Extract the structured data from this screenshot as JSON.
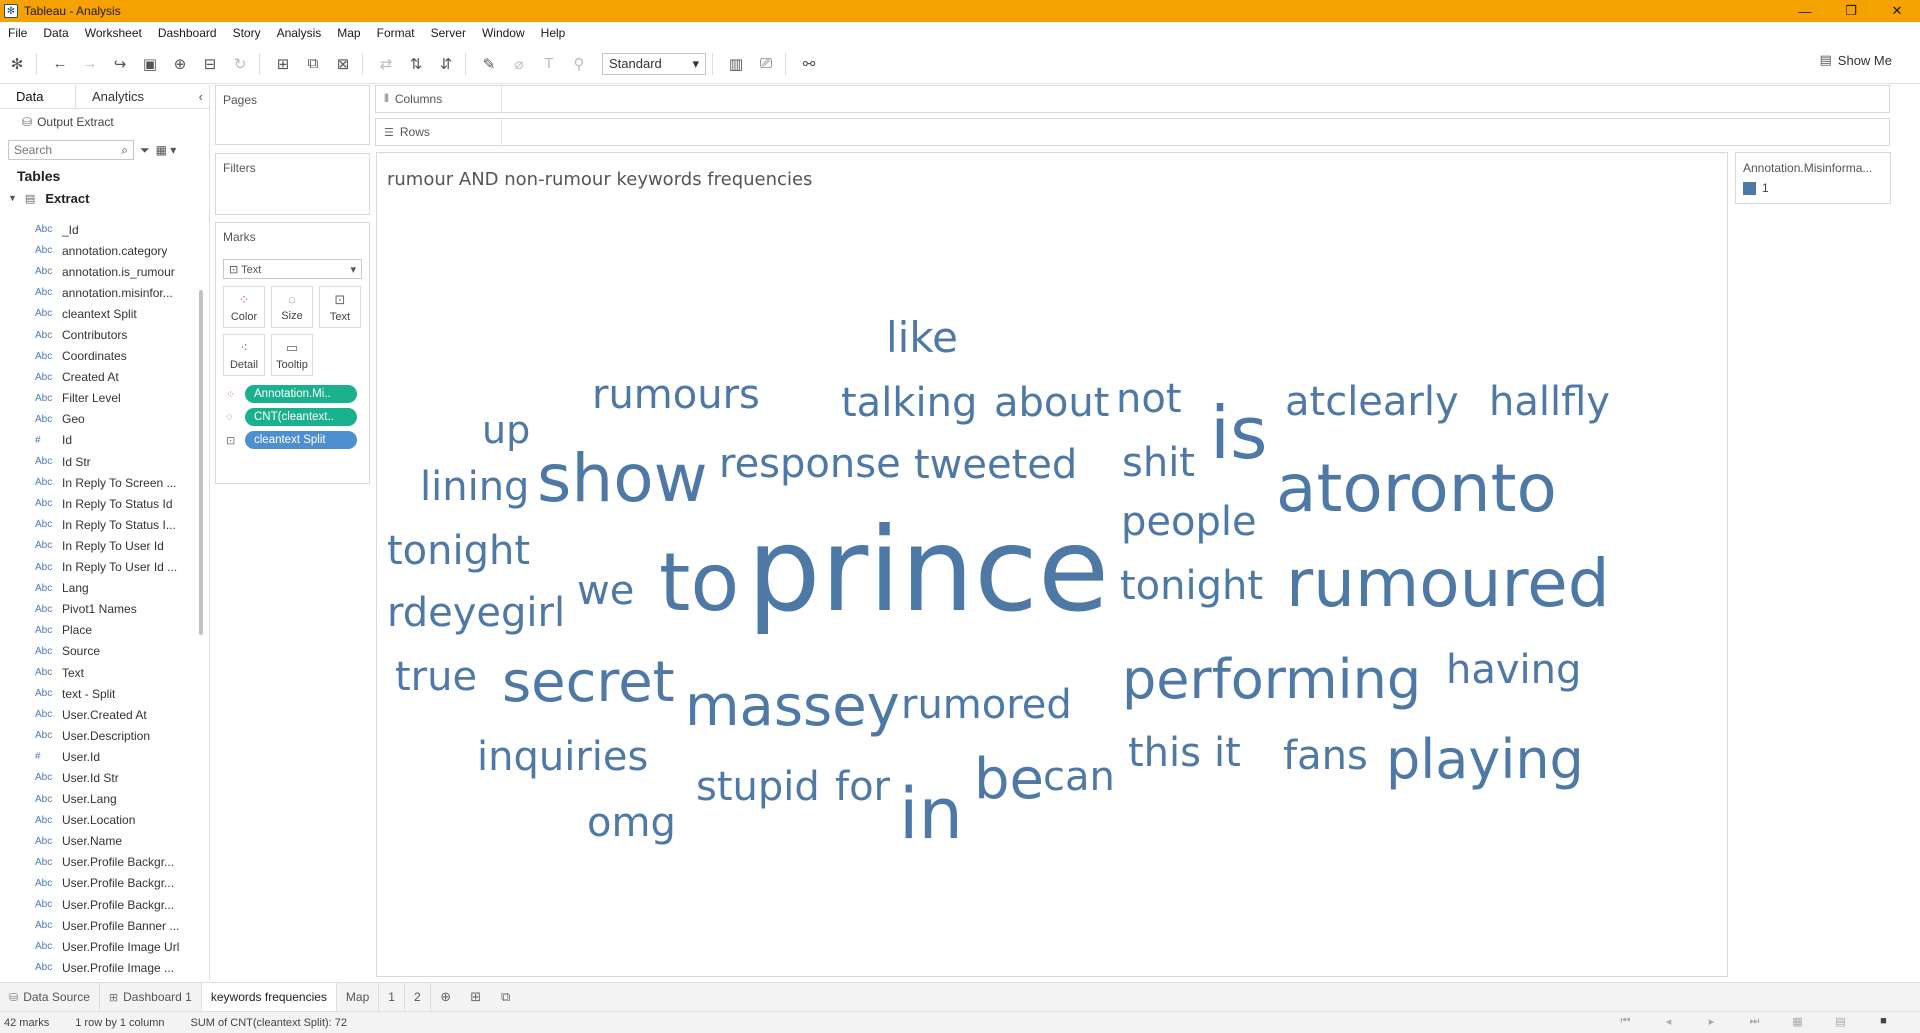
{
  "window": {
    "title": "Tableau - Analysis"
  },
  "menu": [
    "File",
    "Data",
    "Worksheet",
    "Dashboard",
    "Story",
    "Analysis",
    "Map",
    "Format",
    "Server",
    "Window",
    "Help"
  ],
  "toolbar": {
    "fit_select": "Standard",
    "show_me": "Show Me"
  },
  "data_pane": {
    "tab_data": "Data",
    "tab_analytics": "Analytics",
    "data_source": "Output Extract",
    "search_placeholder": "Search",
    "tables_header": "Tables",
    "table_name": "Extract",
    "fields": [
      {
        "type": "Abc",
        "name": "_Id"
      },
      {
        "type": "Abc",
        "name": "annotation.category"
      },
      {
        "type": "Abc",
        "name": "annotation.is_rumour"
      },
      {
        "type": "Abc",
        "name": "annotation.misinfor..."
      },
      {
        "type": "Abc",
        "name": "cleantext Split"
      },
      {
        "type": "Abc",
        "name": "Contributors"
      },
      {
        "type": "Abc",
        "name": "Coordinates"
      },
      {
        "type": "Abc",
        "name": "Created At"
      },
      {
        "type": "Abc",
        "name": "Filter Level"
      },
      {
        "type": "Abc",
        "name": "Geo"
      },
      {
        "type": "#",
        "name": "Id"
      },
      {
        "type": "Abc",
        "name": "Id Str"
      },
      {
        "type": "Abc",
        "name": "In Reply To Screen ..."
      },
      {
        "type": "Abc",
        "name": "In Reply To Status Id"
      },
      {
        "type": "Abc",
        "name": "In Reply To Status I..."
      },
      {
        "type": "Abc",
        "name": "In Reply To User Id"
      },
      {
        "type": "Abc",
        "name": "In Reply To User Id ..."
      },
      {
        "type": "Abc",
        "name": "Lang"
      },
      {
        "type": "Abc",
        "name": "Pivot1 Names"
      },
      {
        "type": "Abc",
        "name": "Place"
      },
      {
        "type": "Abc",
        "name": "Source"
      },
      {
        "type": "Abc",
        "name": "Text"
      },
      {
        "type": "Abc",
        "name": "text - Split"
      },
      {
        "type": "Abc",
        "name": "User.Created At"
      },
      {
        "type": "Abc",
        "name": "User.Description"
      },
      {
        "type": "#",
        "name": "User.Id"
      },
      {
        "type": "Abc",
        "name": "User.Id Str"
      },
      {
        "type": "Abc",
        "name": "User.Lang"
      },
      {
        "type": "Abc",
        "name": "User.Location"
      },
      {
        "type": "Abc",
        "name": "User.Name"
      },
      {
        "type": "Abc",
        "name": "User.Profile Backgr..."
      },
      {
        "type": "Abc",
        "name": "User.Profile Backgr..."
      },
      {
        "type": "Abc",
        "name": "User.Profile Backgr..."
      },
      {
        "type": "Abc",
        "name": "User.Profile Banner ..."
      },
      {
        "type": "Abc",
        "name": "User.Profile Image Url"
      },
      {
        "type": "Abc",
        "name": "User.Profile Image ..."
      }
    ]
  },
  "shelves": {
    "pages": "Pages",
    "filters": "Filters",
    "marks": "Marks",
    "marks_type": "Text",
    "columns": "Columns",
    "rows": "Rows",
    "mark_buttons": {
      "color": "Color",
      "size": "Size",
      "text": "Text",
      "detail": "Detail",
      "tooltip": "Tooltip"
    },
    "pills": [
      "Annotation.Mi..",
      "CNT(cleantext..",
      "cleantext Split"
    ]
  },
  "view": {
    "title": "rumour AND non-rumour keywords frequencies",
    "words": [
      {
        "text": "like",
        "size": 42
      },
      {
        "text": "rumours",
        "size": 40
      },
      {
        "text": "talking",
        "size": 40
      },
      {
        "text": "about",
        "size": 40
      },
      {
        "text": "not",
        "size": 40
      },
      {
        "text": "is",
        "size": 72
      },
      {
        "text": "atclearly",
        "size": 40
      },
      {
        "text": "hallfly",
        "size": 40
      },
      {
        "text": "up",
        "size": 38
      },
      {
        "text": "show",
        "size": 66
      },
      {
        "text": "response",
        "size": 40
      },
      {
        "text": "tweeted",
        "size": 40
      },
      {
        "text": "shit",
        "size": 40
      },
      {
        "text": "atoronto",
        "size": 66
      },
      {
        "text": "lining",
        "size": 40
      },
      {
        "text": "people",
        "size": 40
      },
      {
        "text": "tonight",
        "size": 40
      },
      {
        "text": "we",
        "size": 40
      },
      {
        "text": "to",
        "size": 80
      },
      {
        "text": "prince",
        "size": 116
      },
      {
        "text": "tonight",
        "size": 40
      },
      {
        "text": "rumoured",
        "size": 66
      },
      {
        "text": "rdeyegirl",
        "size": 40
      },
      {
        "text": "true",
        "size": 40
      },
      {
        "text": "secret",
        "size": 56
      },
      {
        "text": "massey",
        "size": 56
      },
      {
        "text": "rumored",
        "size": 40
      },
      {
        "text": "performing",
        "size": 54
      },
      {
        "text": "having",
        "size": 40
      },
      {
        "text": "inquiries",
        "size": 40
      },
      {
        "text": "stupid",
        "size": 40
      },
      {
        "text": "for",
        "size": 40
      },
      {
        "text": "in",
        "size": 70
      },
      {
        "text": "be",
        "size": 56
      },
      {
        "text": "can",
        "size": 40
      },
      {
        "text": "this",
        "size": 40
      },
      {
        "text": "it",
        "size": 40
      },
      {
        "text": "fans",
        "size": 40
      },
      {
        "text": "playing",
        "size": 54
      },
      {
        "text": "omg",
        "size": 40
      }
    ],
    "word_color": "#4e79a7"
  },
  "legend": {
    "title": "Annotation.Misinforma...",
    "item": "1",
    "color": "#4e79a7"
  },
  "sheets": {
    "data_source": "Data Source",
    "dashboard": "Dashboard 1",
    "active": "keywords frequencies",
    "map": "Map",
    "s1": "1",
    "s2": "2"
  },
  "status": {
    "marks": "42 marks",
    "layout": "1 row by 1 column",
    "sum": "SUM of CNT(cleantext Split): 72"
  }
}
